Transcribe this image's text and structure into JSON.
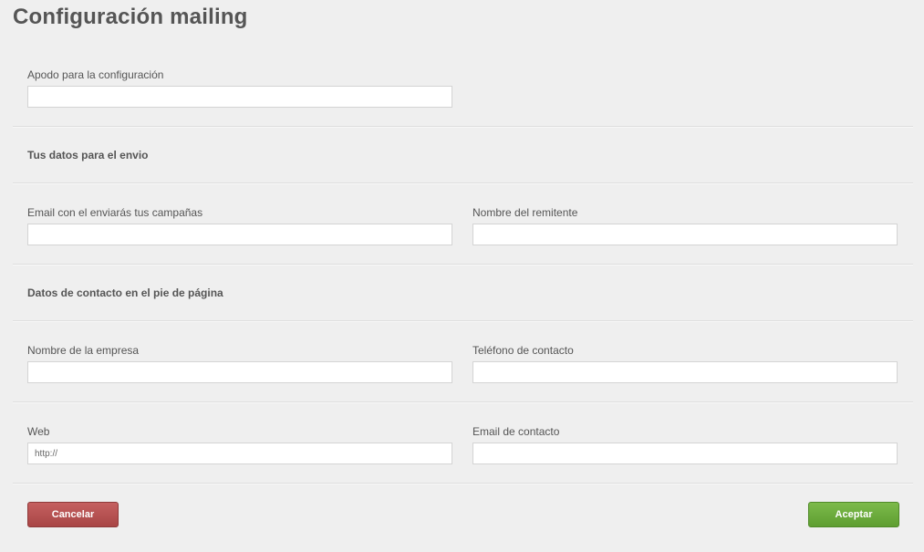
{
  "page": {
    "title": "Configuración mailing"
  },
  "config": {
    "nickname_label": "Apodo para la configuración",
    "nickname_value": ""
  },
  "sender_section": {
    "title": "Tus datos para el envio",
    "email_label": "Email con el enviarás tus campañas",
    "email_value": "",
    "name_label": "Nombre del remitente",
    "name_value": ""
  },
  "footer_section": {
    "title": "Datos de contacto en el pie de página",
    "company_label": "Nombre de la empresa",
    "company_value": "",
    "phone_label": "Teléfono de contacto",
    "phone_value": "",
    "web_label": "Web",
    "web_value": "http://",
    "contact_email_label": "Email de contacto",
    "contact_email_value": ""
  },
  "actions": {
    "cancel_label": "Cancelar",
    "accept_label": "Aceptar"
  },
  "colors": {
    "cancel": "#b24f4f",
    "accept": "#6aac3c",
    "background": "#efefef"
  }
}
